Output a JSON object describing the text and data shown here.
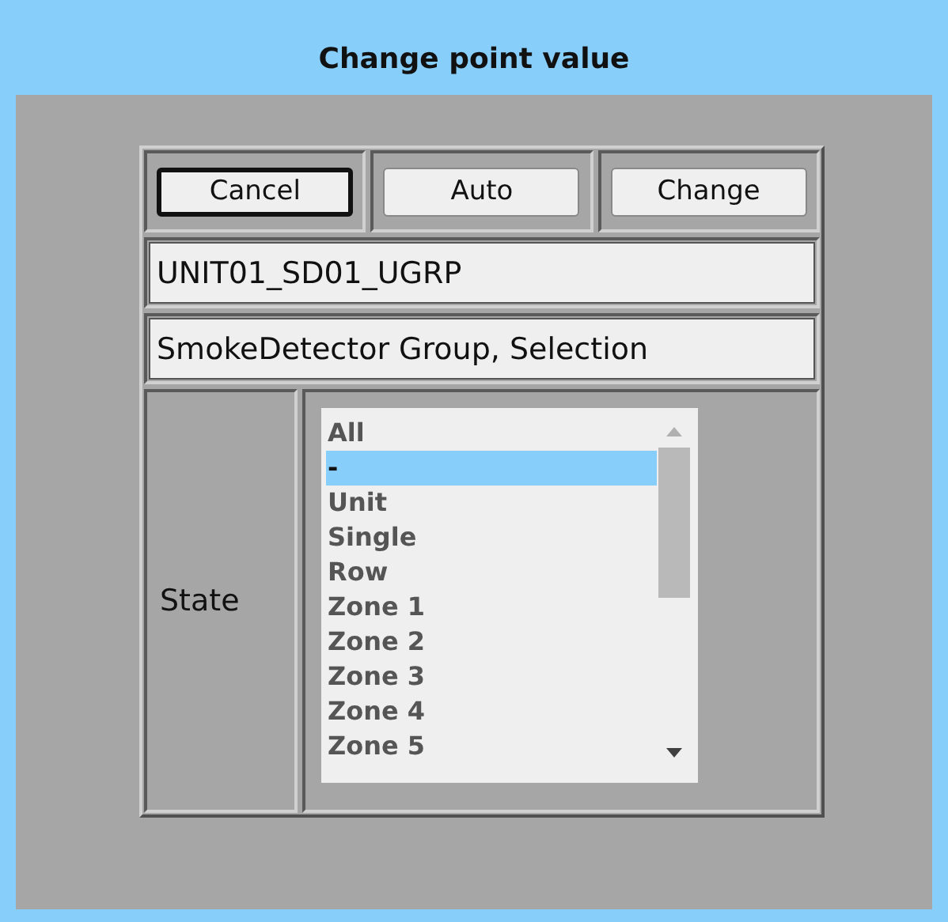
{
  "window": {
    "title": "Change point value"
  },
  "buttons": [
    {
      "label": "Cancel",
      "focused": true
    },
    {
      "label": "Auto",
      "focused": false
    },
    {
      "label": "Change",
      "focused": false
    }
  ],
  "point_name": "UNIT01_SD01_UGRP",
  "point_description": "SmokeDetector Group, Selection",
  "state": {
    "label": "State",
    "options": [
      {
        "label": "All",
        "selected": false
      },
      {
        "label": "-",
        "selected": true
      },
      {
        "label": "Unit",
        "selected": false
      },
      {
        "label": "Single",
        "selected": false
      },
      {
        "label": "Row",
        "selected": false
      },
      {
        "label": "Zone 1",
        "selected": false
      },
      {
        "label": "Zone 2",
        "selected": false
      },
      {
        "label": "Zone 3",
        "selected": false
      },
      {
        "label": "Zone 4",
        "selected": false
      },
      {
        "label": "Zone 5",
        "selected": false
      }
    ]
  }
}
